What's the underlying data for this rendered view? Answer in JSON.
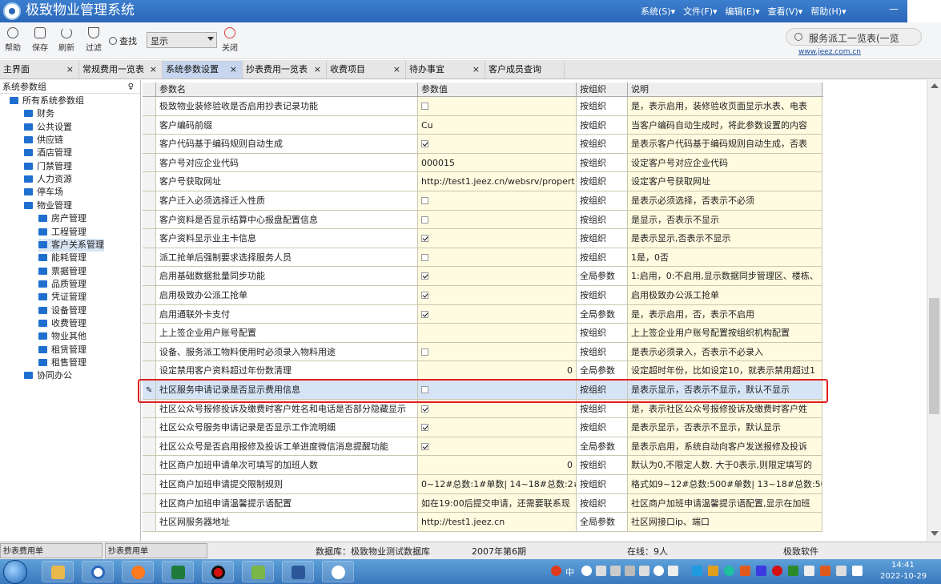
{
  "app": {
    "title": "极致物业管理系统",
    "menus": [
      "系统(S)▾",
      "文件(F)▾",
      "编辑(E)▾",
      "查看(V)▾",
      "帮助(H)▾"
    ],
    "win_min": "—",
    "win_max": "□"
  },
  "toolbar": {
    "help": "帮助",
    "save": "保存",
    "refresh": "刷新",
    "filter": "过滤",
    "find": "查找",
    "show_select": "显示",
    "close": "关闭",
    "search_text": "服务派工一览表(一览",
    "site_link": "www.jeez.com.cn"
  },
  "tabs": [
    {
      "label": "主界面",
      "active": false
    },
    {
      "label": "常规费用一览表",
      "active": false
    },
    {
      "label": "系统参数设置",
      "active": true
    },
    {
      "label": "抄表费用一览表",
      "active": false
    },
    {
      "label": "收费项目",
      "active": false
    },
    {
      "label": "待办事宜",
      "active": false
    },
    {
      "label": "客户成员查询",
      "active": false
    }
  ],
  "tab_close": "×",
  "sidebar": {
    "title": "系统参数组",
    "pin": "♀",
    "nodes": [
      {
        "label": "所有系统参数组",
        "level": 0
      },
      {
        "label": "财务",
        "level": 1
      },
      {
        "label": "公共设置",
        "level": 1
      },
      {
        "label": "供应链",
        "level": 1
      },
      {
        "label": "酒店管理",
        "level": 1
      },
      {
        "label": "门禁管理",
        "level": 1
      },
      {
        "label": "人力资源",
        "level": 1
      },
      {
        "label": "停车场",
        "level": 1
      },
      {
        "label": "物业管理",
        "level": 1
      },
      {
        "label": "房产管理",
        "level": 2
      },
      {
        "label": "工程管理",
        "level": 2
      },
      {
        "label": "客户关系管理",
        "level": 2,
        "selected": true
      },
      {
        "label": "能耗管理",
        "level": 2
      },
      {
        "label": "票据管理",
        "level": 2
      },
      {
        "label": "品质管理",
        "level": 2
      },
      {
        "label": "凭证管理",
        "level": 2
      },
      {
        "label": "设备管理",
        "level": 2
      },
      {
        "label": "收费管理",
        "level": 2
      },
      {
        "label": "物业其他",
        "level": 2
      },
      {
        "label": "租赁管理",
        "level": 2
      },
      {
        "label": "租售管理",
        "level": 2
      },
      {
        "label": "协同办公",
        "level": 1
      }
    ]
  },
  "grid": {
    "headers": [
      "参数名",
      "参数值",
      "按组织",
      "说明"
    ],
    "rows": [
      {
        "name": "极致物业装修验收是否启用抄表记录功能",
        "value": "",
        "check": false,
        "org": "按组织",
        "desc": "是，表示启用，装修验收页面显示水表、电表"
      },
      {
        "name": "客户编码前缀",
        "value": "Cu",
        "org": "按组织",
        "desc": "当客户编码自动生成时，将此参数设置的内容"
      },
      {
        "name": "客户代码基于编码规则自动生成",
        "value": "",
        "check": true,
        "org": "按组织",
        "desc": "是表示客户代码基于编码规则自动生成，否表"
      },
      {
        "name": "客户号对应企业代码",
        "value": "000015",
        "org": "按组织",
        "desc": "设定客户号对应企业代码"
      },
      {
        "name": "客户号获取网址",
        "value": "http://test1.jeez.cn/websrv/propert",
        "org": "按组织",
        "desc": "设定客户号获取网址"
      },
      {
        "name": "客户迁入必须选择迁入性质",
        "value": "",
        "check": false,
        "org": "按组织",
        "desc": "是表示必须选择，否表示不必须"
      },
      {
        "name": "客户资料是否显示结算中心报盘配置信息",
        "value": "",
        "check": false,
        "org": "按组织",
        "desc": "是显示，否表示不显示"
      },
      {
        "name": "客户资料显示业主卡信息",
        "value": "",
        "check": true,
        "org": "按组织",
        "desc": "是表示显示,否表示不显示"
      },
      {
        "name": "派工抢单后强制要求选择服务人员",
        "value": "",
        "check": false,
        "org": "按组织",
        "desc": "1是，0否"
      },
      {
        "name": "启用基础数据批量同步功能",
        "value": "",
        "check": true,
        "org": "全局参数",
        "desc": "1:启用，0:不启用,显示数据同步管理区、楼栋、"
      },
      {
        "name": "启用极致办公派工抢单",
        "value": "",
        "check": true,
        "org": "按组织",
        "desc": "启用极致办公派工抢单"
      },
      {
        "name": "启用通联外卡支付",
        "value": "",
        "check": true,
        "org": "全局参数",
        "desc": "是，表示启用，否，表示不启用"
      },
      {
        "name": "上上签企业用户账号配置",
        "value": "",
        "org": "按组织",
        "desc": "上上签企业用户账号配置按组织机构配置"
      },
      {
        "name": "设备、服务派工物料使用时必须录入物料用途",
        "value": "",
        "check": false,
        "org": "按组织",
        "desc": "是表示必须录入，否表示不必录入"
      },
      {
        "name": "设定禁用客户资料超过年份数清理",
        "value": "0",
        "num": true,
        "org": "全局参数",
        "desc": "设定超时年份，比如设定10，就表示禁用超过1"
      },
      {
        "name": "社区服务申请记录是否显示费用信息",
        "value": "",
        "check": false,
        "org": "按组织",
        "desc": "是表示显示，否表示不显示，默认不显示",
        "selected": true
      },
      {
        "name": "社区公众号报修投诉及缴费时客户姓名和电话是否部分隐藏显示",
        "value": "",
        "check": true,
        "org": "按组织",
        "desc": "是，表示社区公众号报修投诉及缴费时客户姓"
      },
      {
        "name": "社区公众号服务申请记录是否显示工作流明细",
        "value": "",
        "check": true,
        "org": "按组织",
        "desc": "是表示显示，否表示不显示，默认显示"
      },
      {
        "name": "社区公众号是否启用报修及投诉工单进度微信消息提醒功能",
        "value": "",
        "check": true,
        "org": "全局参数",
        "desc": "是表示启用，系统自动向客户发送报修及投诉"
      },
      {
        "name": "社区商户加班申请单次可填写的加班人数",
        "value": "0",
        "num": true,
        "org": "按组织",
        "desc": "默认为0,不限定人数. 大于0表示,则限定填写的"
      },
      {
        "name": "社区商户加班申请提交限制规则",
        "value": "0~12#总数:1#单数| 14~18#总数:2#",
        "org": "按组织",
        "desc": "格式如9~12#总数:500#单数| 13~18#总数:50"
      },
      {
        "name": "社区商户加班申请温馨提示语配置",
        "value": "如在19:00后提交申请，还需要联系现",
        "org": "按组织",
        "desc": "社区商户加班申请温馨提示语配置,显示在加班"
      },
      {
        "name": "社区网服务器地址",
        "value": "http://test1.jeez.cn",
        "org": "全局参数",
        "desc": "社区网接口ip、端口"
      }
    ]
  },
  "status": {
    "tab1": "抄表费用单",
    "tab2": "抄表费用单",
    "db": "数据库：极致物业测试数据库",
    "period": "2007年第6期",
    "online": "在线：9人",
    "vendor": "极致软件"
  },
  "clock": {
    "time": "14:41",
    "date": "2022-10-29"
  },
  "tray_text": "中"
}
